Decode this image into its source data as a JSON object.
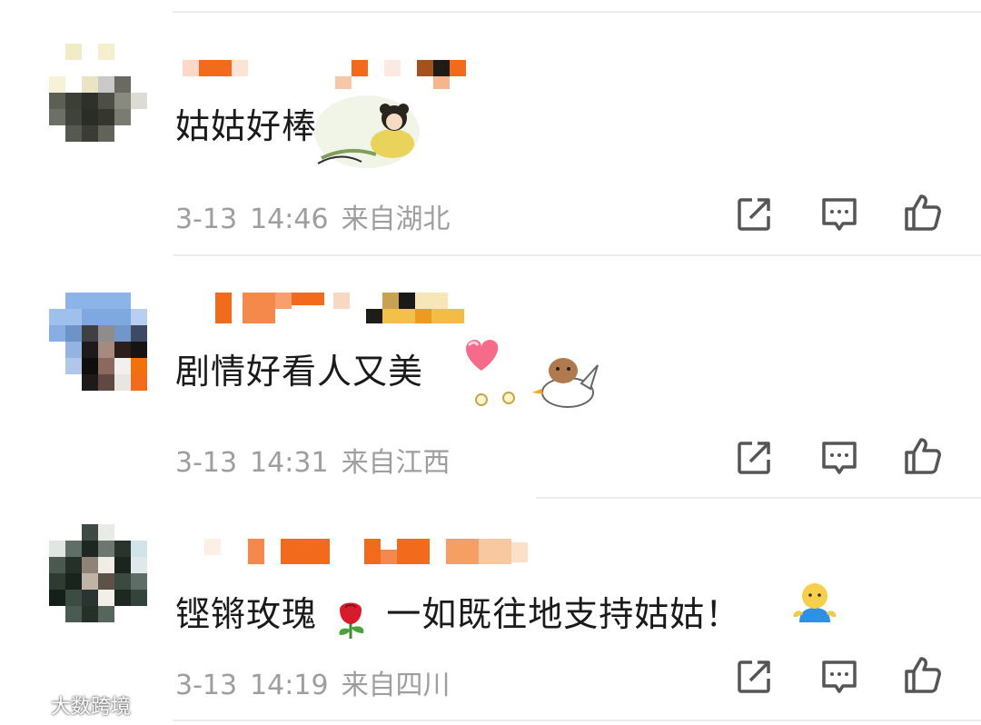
{
  "comments": [
    {
      "text": "姑姑好棒",
      "date": "3-13",
      "time": "14:46",
      "location": "来自湖北",
      "sticker": "girl-character-sticker"
    },
    {
      "text": "剧情好看人又美",
      "date": "3-13",
      "time": "14:31",
      "location": "来自江西",
      "sticker": "heart-and-capybara-on-goose-sticker"
    },
    {
      "text": "铿锵玫瑰",
      "text_after": "一如既往地支持姑姑！",
      "date": "3-13",
      "time": "14:19",
      "location": "来自四川",
      "sticker": "rose-emoji",
      "trailing_emoji": "person-emoji"
    }
  ],
  "actions": {
    "share_icon": "share-icon",
    "comment_icon": "comment-icon",
    "like_icon": "like-icon"
  },
  "watermark": {
    "text": "大数跨境"
  },
  "colors": {
    "text": "#1a1a1a",
    "meta": "#9e9e9e",
    "divider": "#ececec",
    "nickname_orange": "#f26b1d"
  }
}
